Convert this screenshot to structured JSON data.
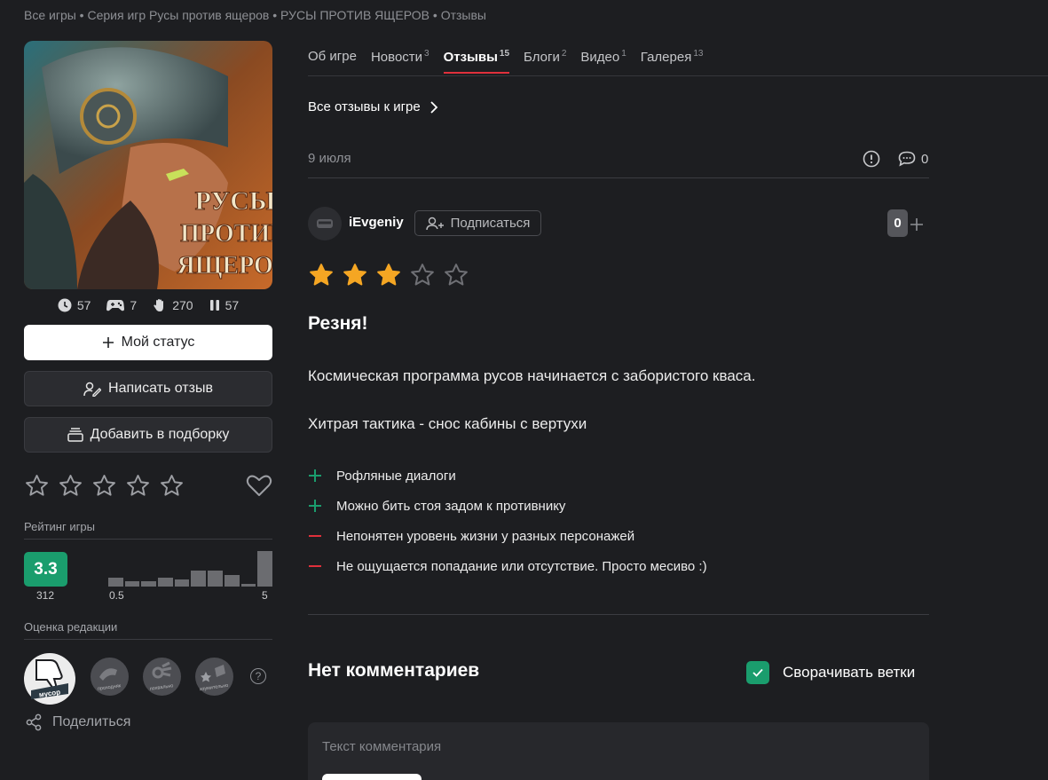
{
  "breadcrumb": [
    "Все игры",
    "Серия игр Русы против ящеров",
    "РУСЫ ПРОТИВ ЯЩЕРОВ",
    "Отзывы"
  ],
  "breadcrumb_sep": " • ",
  "cover_text": [
    "РУСЫ",
    "ПРОТИВ",
    "ЯЩЕРОВ"
  ],
  "stats": [
    {
      "icon": "clock-icon",
      "value": "57"
    },
    {
      "icon": "gamepad-icon",
      "value": "7"
    },
    {
      "icon": "hand-icon",
      "value": "270"
    },
    {
      "icon": "pause-icon",
      "value": "57"
    }
  ],
  "buttons": {
    "my_status": "Мой статус",
    "write_review": "Написать отзыв",
    "add_collection": "Добавить в подборку"
  },
  "rating": {
    "label": "Рейтинг игры",
    "score": "3.3",
    "votes": "312",
    "min_label": "0.5",
    "max_label": "5",
    "histogram": [
      0.25,
      0.15,
      0.15,
      0.25,
      0.2,
      0.45,
      0.45,
      0.32,
      0.08,
      1.0
    ]
  },
  "editor": {
    "label": "Оценка редакции",
    "badges": [
      "мусор",
      "проходняк",
      "похвально",
      "изумительно"
    ],
    "help": "?"
  },
  "share": "Поделиться",
  "tabs": [
    {
      "label": "Об игре",
      "count": ""
    },
    {
      "label": "Новости",
      "count": "3"
    },
    {
      "label": "Отзывы",
      "count": "15"
    },
    {
      "label": "Блоги",
      "count": "2"
    },
    {
      "label": "Видео",
      "count": "1"
    },
    {
      "label": "Галерея",
      "count": "13"
    }
  ],
  "all_reviews": "Все отзывы к игре",
  "review": {
    "date": "9 июля",
    "comments_count": "0",
    "username": "iEvgeniy",
    "subscribe": "Подписаться",
    "karma": "0",
    "stars": 3,
    "title": "Резня!",
    "paragraphs": [
      "Космическая программа русов начинается с забористого кваса.",
      "Хитрая тактика - снос кабины с вертухи"
    ],
    "pros": [
      "Рофляные диалоги",
      "Можно бить стоя задом к противнику"
    ],
    "cons": [
      "Непонятен уровень жизни у разных персонажей",
      "Не ощущается попадание или отсутствие. Просто месиво :)"
    ]
  },
  "comments": {
    "title": "Нет комментариев",
    "fold_label": "Сворачивать ветки",
    "placeholder": "Текст комментария"
  },
  "colors": {
    "accent_green": "#1a9d6d",
    "tab_underline": "#e0303b",
    "star_filled": "#f5a623",
    "con_red": "#e0303b"
  }
}
